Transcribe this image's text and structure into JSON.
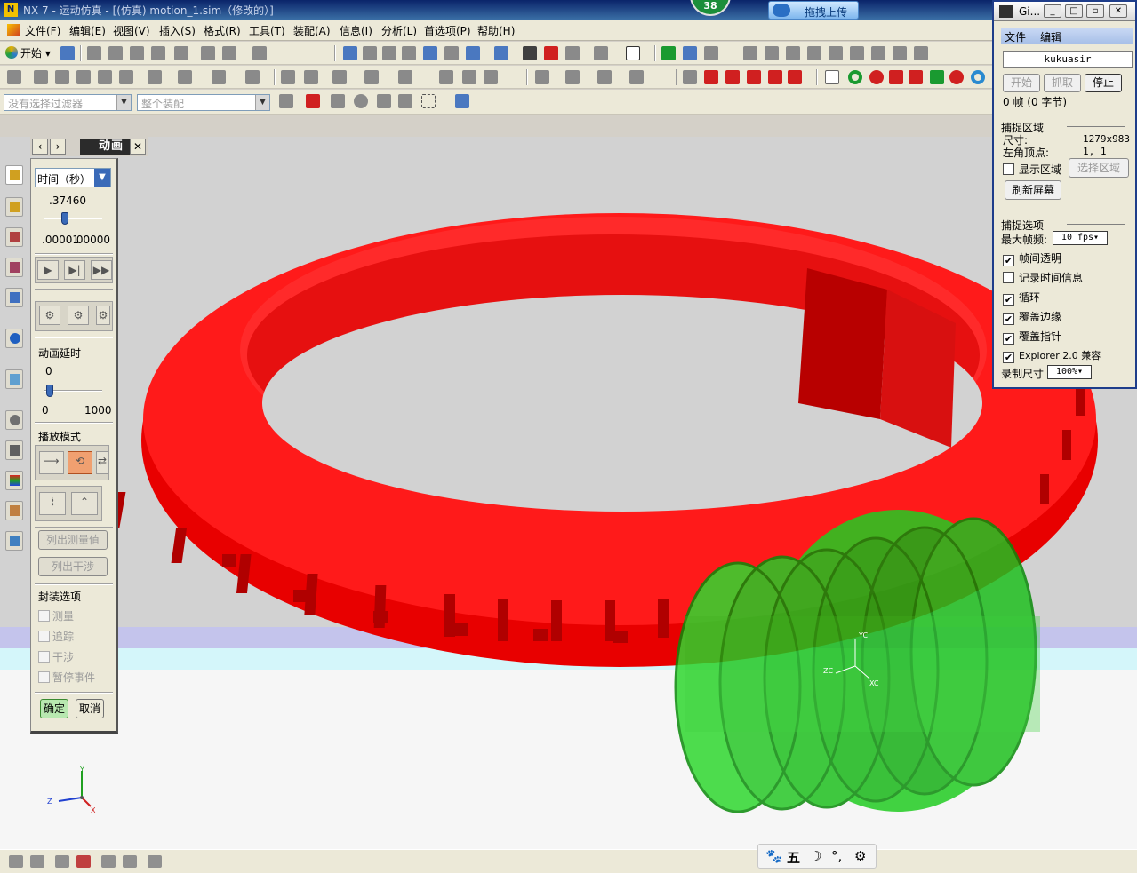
{
  "window": {
    "title": "NX 7 - 运动仿真 - [(仿真) motion_1.sim（修改的）]",
    "badge_count": "38",
    "upload_label": "拖拽上传"
  },
  "menubar": {
    "items": [
      "文件(F)",
      "编辑(E)",
      "视图(V)",
      "插入(S)",
      "格式(R)",
      "工具(T)",
      "装配(A)",
      "信息(I)",
      "分析(L)",
      "首选项(P)",
      "帮助(H)"
    ]
  },
  "toolbar": {
    "start_label": "开始",
    "filter_placeholder": "没有选择过滤器",
    "assembly_placeholder": "整个装配"
  },
  "animation_dialog": {
    "title": "动画",
    "time_unit": "时间（秒）",
    "time_value": ".37460",
    "time_range_min": ".00001",
    "time_range_max": ".00000",
    "time_fraction": 0.37,
    "delay_label": "动画延时",
    "delay_value": "0",
    "delay_min": "0",
    "delay_max": "1000",
    "play_mode_label": "播放模式",
    "list_measure_label": "列出测量值",
    "list_interference_label": "列出干涉",
    "envelope_label": "封装选项",
    "options": [
      "测量",
      "追踪",
      "干涉",
      "暂停事件"
    ],
    "ok_label": "确定",
    "cancel_label": "取消"
  },
  "triad": {
    "x": "X",
    "y": "Y",
    "z": "Z"
  },
  "model_triad": {
    "xc": "XC",
    "yc": "YC",
    "zc": "ZC"
  },
  "gif_window": {
    "title": "Gi...",
    "menu": [
      "文件",
      "编辑"
    ],
    "name": "kukuasir",
    "btn_start": "开始",
    "btn_capture": "抓取",
    "btn_stop": "停止",
    "frame_info": "0 帧 (0 字节)",
    "capture_area_label": "捕捉区域",
    "size_label": "尺寸:",
    "size_value": "1279x983",
    "corner_label": "左角顶点:",
    "corner_value": "1, 1",
    "show_area_label": "显示区域",
    "select_area_label": "选择区域",
    "refresh_label": "刷新屏幕",
    "capture_options_label": "捕捉选项",
    "max_fps_label": "最大帧频:",
    "max_fps_value": "10 fps",
    "opt_transparent": "帧间透明",
    "opt_timeinfo": "记录时间信息",
    "opt_loop": "循环",
    "opt_border": "覆盖边缘",
    "opt_pointer": "覆盖指针",
    "opt_explorer": "Explorer 2.0 兼容",
    "record_size_label": "录制尺寸",
    "record_size_value": "100%"
  },
  "ime": {
    "mode": "五"
  },
  "colors": {
    "tire": "#ff0000",
    "gear": "#22cc22",
    "title_bar": "#0a246a"
  }
}
